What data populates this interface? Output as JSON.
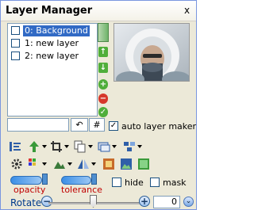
{
  "window": {
    "title": "Layer Manager",
    "close_symbol": "x"
  },
  "layers": [
    {
      "label": "0: Background",
      "selected": true,
      "checked": false
    },
    {
      "label": "1: new layer",
      "selected": false,
      "checked": false
    },
    {
      "label": "2: new layer",
      "selected": false,
      "checked": false
    }
  ],
  "layer_name_field": {
    "value": ""
  },
  "buttons": {
    "undo_symbol": "↶",
    "hash_label": "#"
  },
  "auto_layer_maker": {
    "label": "auto layer maker",
    "checked": true
  },
  "hide": {
    "label": "hide",
    "checked": false
  },
  "mask": {
    "label": "mask",
    "checked": false
  },
  "labels": {
    "opacity": "opacity",
    "tolerance": "tolerance",
    "rotate": "Rotate"
  },
  "rotate": {
    "value": "0",
    "minus_symbol": "−",
    "plus_symbol": "+"
  },
  "expand_symbol": "⌄",
  "sidebar_buttons": [
    "up-arrow",
    "down-arrow",
    "add",
    "remove",
    "confirm"
  ],
  "colors": {
    "selection": "#316ac5",
    "red_label": "#c00000",
    "green": "#4fae3a",
    "red": "#d6372b"
  }
}
